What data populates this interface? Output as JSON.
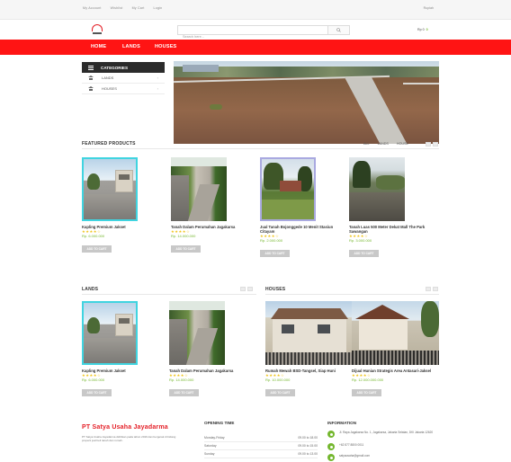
{
  "topbar": {
    "links": [
      "My Account",
      "Wishlist",
      "My Cart",
      "Login"
    ],
    "currency": "Rupiah"
  },
  "header": {
    "search_placeholder": "Search here...",
    "cart_amount": "Rp 0",
    "cart_count": "0"
  },
  "nav": {
    "items": [
      "HOME",
      "LANDS",
      "HOUSES"
    ]
  },
  "categories": {
    "title": "CATEGORIES",
    "items": [
      "LANDS",
      "HOUSES"
    ]
  },
  "featured": {
    "title": "FEATURED PRODUCTS",
    "filters": [
      "ALL",
      "LANDS",
      "HOUSE"
    ],
    "products": [
      {
        "name": "Kapling Premium Jakset",
        "price": "Rp. 6.000.000",
        "stars": "★★★★☆",
        "button": "ADD TO CART"
      },
      {
        "name": "Tanah Dalam Perumahan Jagakarsa",
        "price": "Rp. 14.000.000",
        "stars": "★★★★☆",
        "button": "ADD TO CART"
      },
      {
        "name": "Jual Tanah Bojonggede 10 Menit Stasiun Citayam",
        "price": "Rp. 2.000.000",
        "stars": "★★★★☆",
        "button": "ADD TO CART"
      },
      {
        "name": "Tanah Luas 500 Meter Dekat Mall The Park Sawangan",
        "price": "Rp. 3.000.000",
        "stars": "★★★★☆",
        "button": "ADD TO CART"
      }
    ]
  },
  "lands": {
    "title": "LANDS",
    "products": [
      {
        "name": "Kapling Premium Jakset",
        "price": "Rp. 6.000.000",
        "stars": "★★★★☆",
        "button": "ADD TO CART"
      },
      {
        "name": "Tanah Dalam Perumahan Jagakarsa",
        "price": "Rp. 14.000.000",
        "stars": "★★★★☆",
        "button": "ADD TO CART"
      }
    ]
  },
  "houses": {
    "title": "HOUSES",
    "products": [
      {
        "name": "Rumah Mewah BSD-Tangsel, Siap Huni",
        "price": "Rp. 10.000.000",
        "stars": "★★★★☆",
        "button": "ADD TO CART"
      },
      {
        "name": "Dijual Hunian Strategis Area Antasari-Jaksel",
        "price": "Rp. 12.000.000.000",
        "stars": "★★★★☆",
        "button": "ADD TO CART"
      }
    ]
  },
  "footer": {
    "brand": "PT Satya Usaha Jayadarma",
    "description": "PT Satya Usaha Jayadarma didirikan pada tahun 2019 dan bergerak di bidang properti jual beli tanah dan rumah.",
    "hours_title": "OPENING TIME",
    "hours": [
      {
        "day": "Monday-Friday",
        "time": "09.00 to 18.00"
      },
      {
        "day": "Saturday",
        "time": "09.00 to 15.00"
      },
      {
        "day": "Sunday",
        "time": "09.00 to 13.00"
      }
    ],
    "info_title": "INFORMATION",
    "info": [
      "Jl. Raya Jagakarsa No. 1, Jagakarsa, Jakarta Selatan, DKI Jakarta 12620",
      "+62 877 8800 0011",
      "satyausaha@gmail.com"
    ]
  },
  "colors": {
    "nav_red": "#ff1414",
    "brand_red": "#e41e26",
    "price_green": "#74b72e",
    "star_yellow": "#f0c419",
    "highlight_cyan": "#40d4e0"
  }
}
